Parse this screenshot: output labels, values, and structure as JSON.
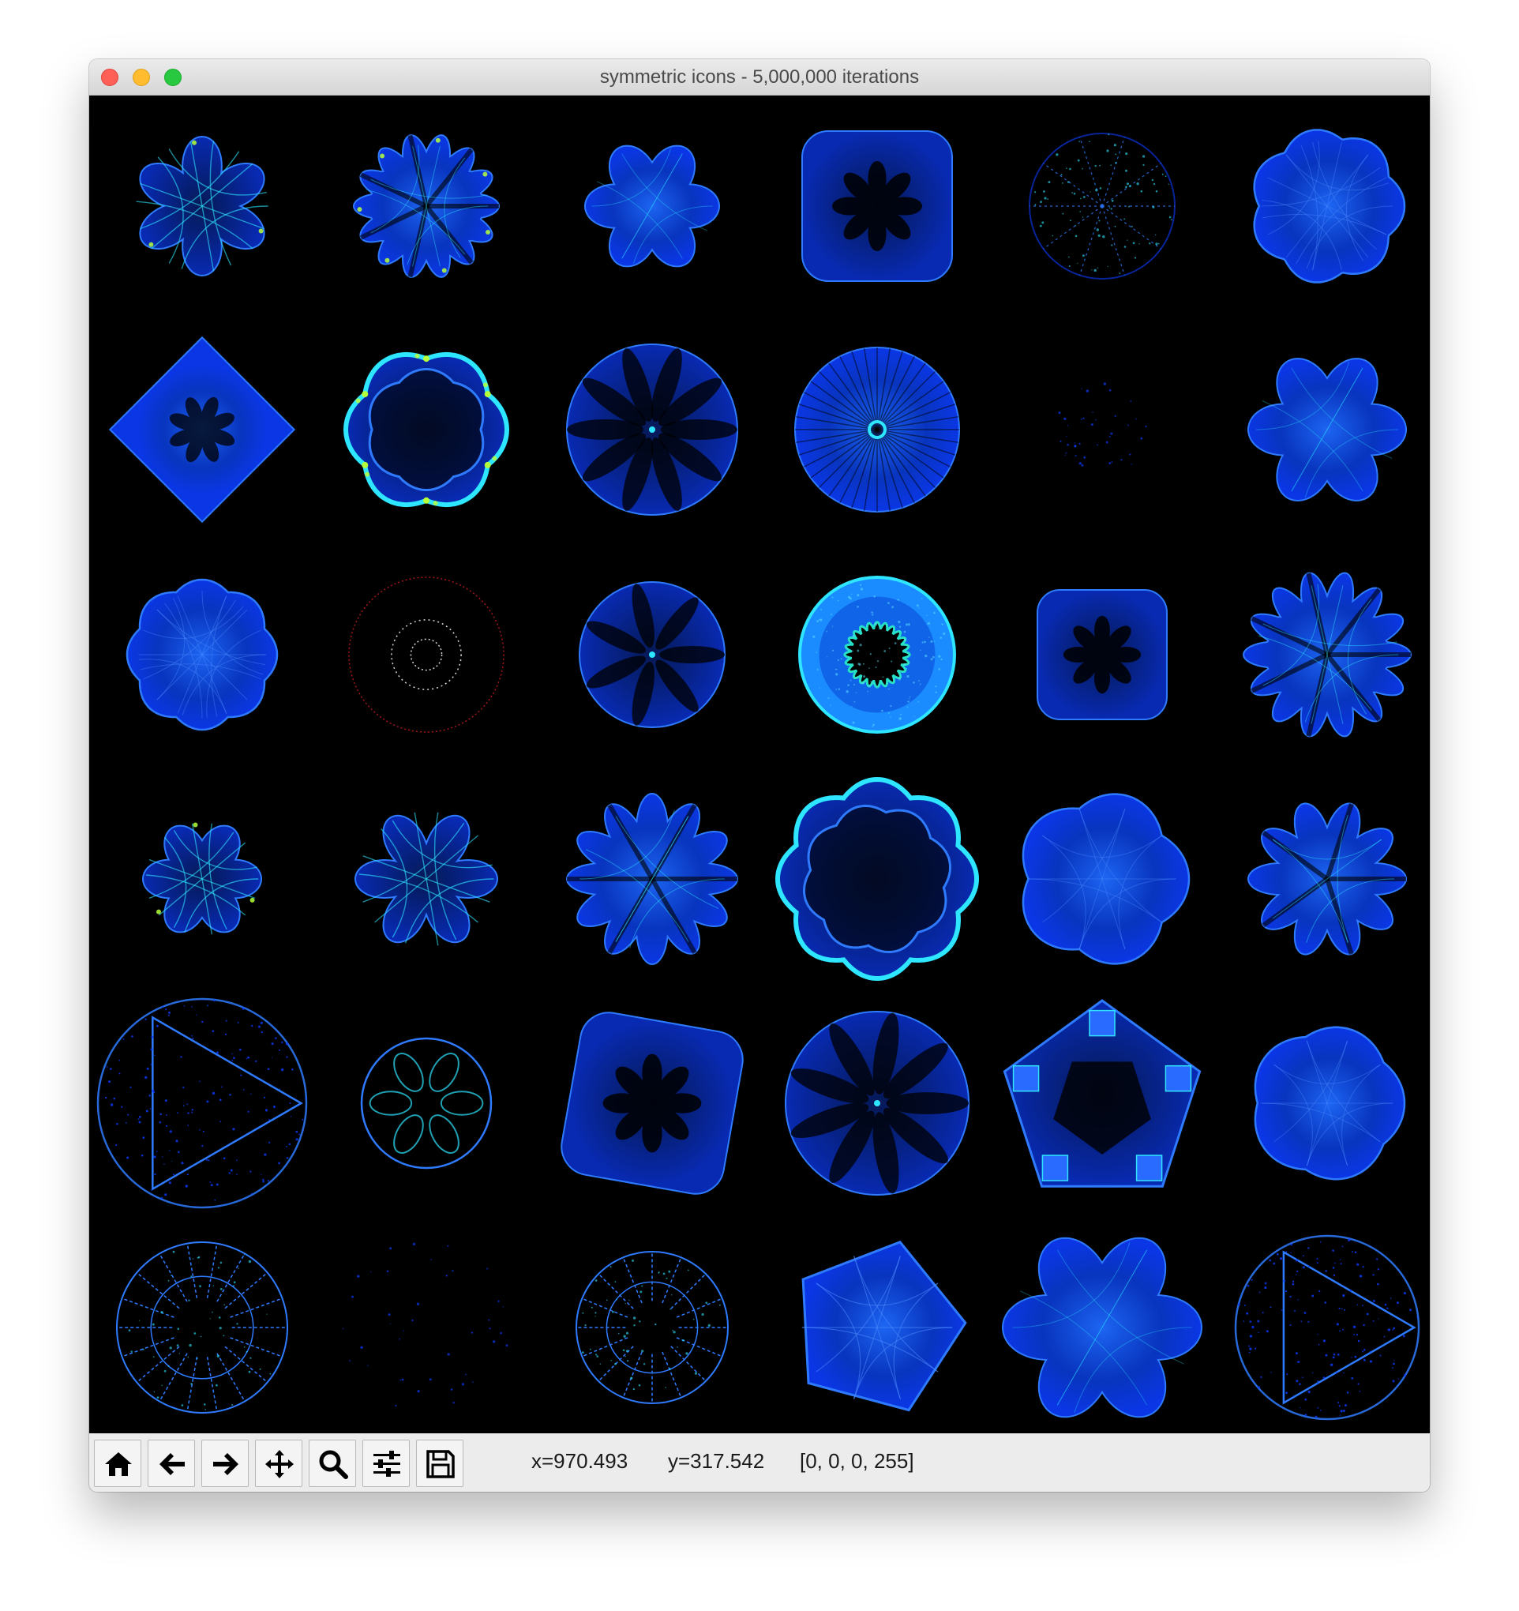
{
  "window": {
    "title": "symmetric icons - 5,000,000 iterations"
  },
  "toolbar": {
    "buttons": [
      {
        "name": "home-button",
        "icon": "home-icon"
      },
      {
        "name": "back-button",
        "icon": "arrow-left-icon"
      },
      {
        "name": "forward-button",
        "icon": "arrow-right-icon"
      },
      {
        "name": "pan-button",
        "icon": "move-icon"
      },
      {
        "name": "zoom-button",
        "icon": "magnifier-icon"
      },
      {
        "name": "configure-subplots-button",
        "icon": "sliders-icon"
      },
      {
        "name": "save-button",
        "icon": "floppy-disk-icon"
      }
    ]
  },
  "status": {
    "x": "x=970.493",
    "y": "y=317.542",
    "pixel": "[0, 0, 0, 255]"
  },
  "colors": {
    "icon_blue": "#0b3cff",
    "icon_bright": "#2f7bff",
    "icon_highlight": "#2ee6ff",
    "icon_hot": "#b6ff3c",
    "background": "#000000"
  }
}
